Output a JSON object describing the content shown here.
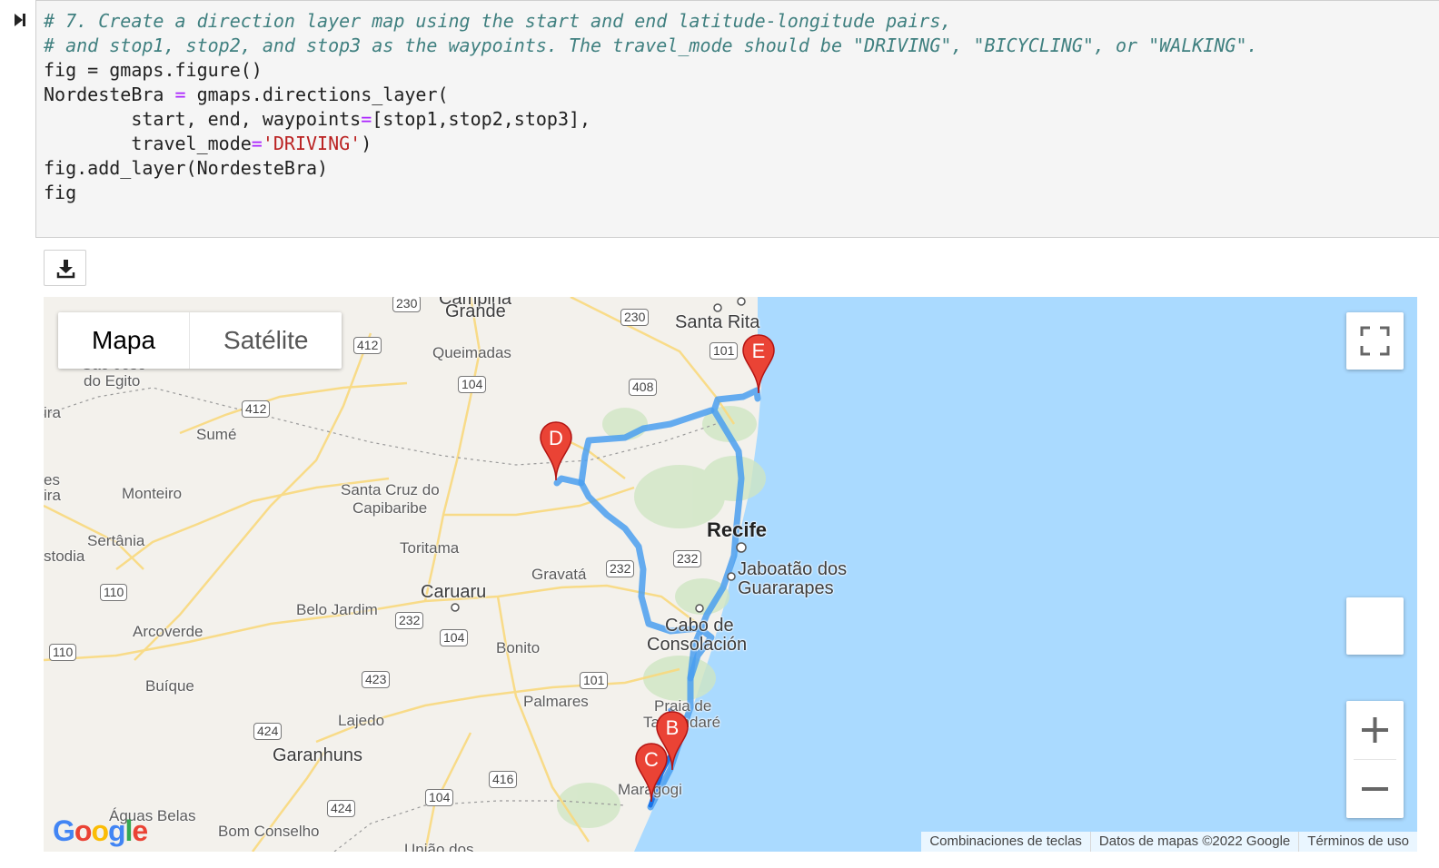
{
  "notebook": {
    "run_icon": "step-forward-icon",
    "code_lines": {
      "l1": "# 7. Create a direction layer map using the start and end latitude-longitude pairs,",
      "l2": "# and stop1, stop2, and stop3 as the waypoints. The travel_mode should be \"DRIVING\", \"BICYCLING\", or \"WALKING\".",
      "l3": "fig = gmaps.figure()",
      "l4a": "NordesteBra ",
      "l4op": "=",
      "l4b": " gmaps.directions_layer(",
      "l5a": "        start, end, waypoints",
      "l5op": "=",
      "l5b": "[stop1,stop2,stop3],",
      "l6a": "        travel_mode",
      "l6op": "=",
      "l6str": "'DRIVING'",
      "l6b": ")",
      "l7": "fig.add_layer(NordesteBra)",
      "l8": "fig"
    },
    "download_icon": "download-icon"
  },
  "map": {
    "type_control": {
      "map": "Mapa",
      "satellite": "Satélite"
    },
    "colors": {
      "route": "#4a9ff0",
      "route_dark": "#1a73e8",
      "water": "#aadaff",
      "land": "#f3f1ec",
      "marker": "#ea4335"
    },
    "markers": [
      "B",
      "C",
      "D",
      "E"
    ],
    "places": {
      "campina": "Campina",
      "grande": "Grande",
      "santa_rita": "Santa Rita",
      "queimadas": "Queimadas",
      "sao_jose": "São José",
      "do_egito": "do Egito",
      "sume": "Sumé",
      "monteiro": "Monteiro",
      "santa_cruz_1": "Santa Cruz do",
      "santa_cruz_2": "Capibaribe",
      "toritama": "Toritama",
      "sertania": "Sertânia",
      "caruaru": "Caruaru",
      "gravata": "Gravatá",
      "recife": "Recife",
      "jaboatao_1": "Jaboatão dos",
      "jaboatao_2": "Guararapes",
      "belo_jardim": "Belo Jardim",
      "arcoverde": "Arcoverde",
      "cabo_1": "Cabo de",
      "cabo_2": "Consolación",
      "bonito": "Bonito",
      "buique": "Buíque",
      "palmares": "Palmares",
      "praia_1": "Praia de",
      "praia_2": "Tamandaré",
      "lajedo": "Lajedo",
      "garanhuns": "Garanhuns",
      "maragogi": "Maragogi",
      "aguas_belas": "Águas Belas",
      "bom_conselho": "Bom Conselho",
      "uniao": "União dos",
      "ira": "ira",
      "ra": "ira",
      "es": "es",
      "stodia": "stodia"
    },
    "shields": {
      "s230a": "230",
      "s230b": "230",
      "s412a": "412",
      "s412b": "412",
      "s101a": "101",
      "s104a": "104",
      "s408": "408",
      "s232a": "232",
      "s232b": "232",
      "s232c": "232",
      "s110a": "110",
      "s110b": "110",
      "s104b": "104",
      "s423": "423",
      "s101b": "101",
      "s424a": "424",
      "s424b": "424",
      "s416": "416",
      "s104c": "104"
    },
    "controls": {
      "fullscreen_icon": "fullscreen-icon",
      "zoom_in": "+",
      "zoom_out": "−"
    },
    "footer": {
      "shortcuts": "Combinaciones de teclas",
      "data": "Datos de mapas ©2022 Google",
      "terms": "Términos de uso"
    },
    "logo": "Google"
  }
}
